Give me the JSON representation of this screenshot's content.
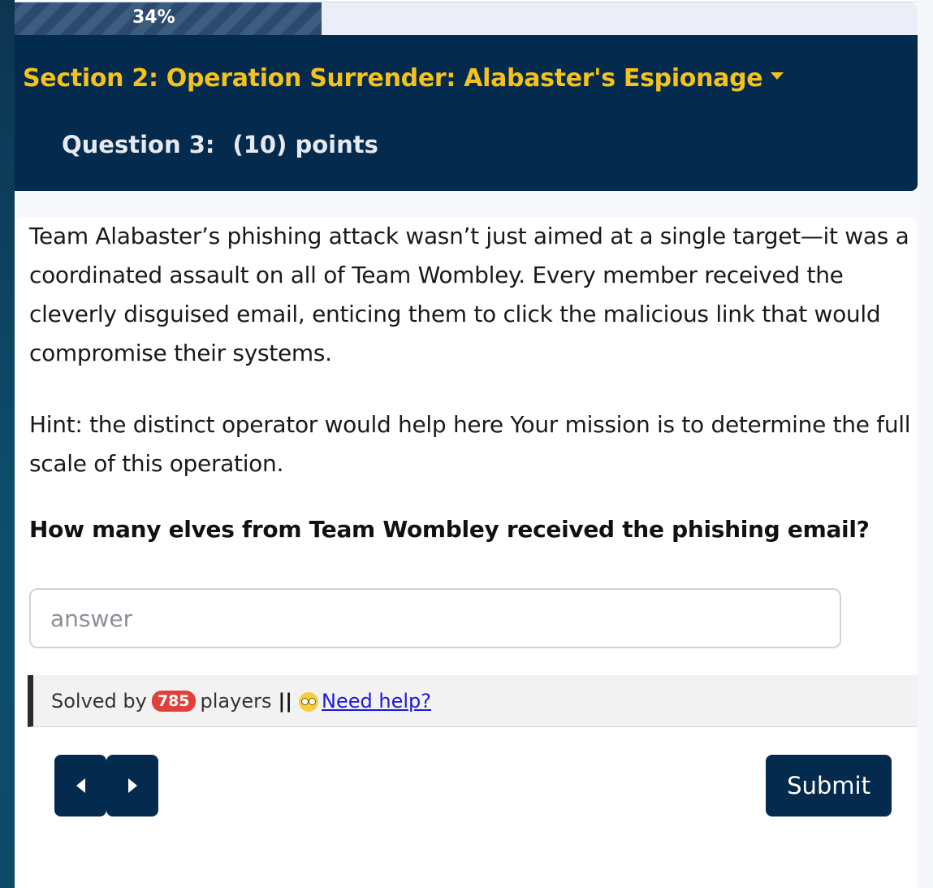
{
  "progress": {
    "label": "34%",
    "value": 0.34
  },
  "header": {
    "section_title": "Section 2: Operation Surrender: Alabaster's Espionage",
    "question_label": "Question 3:",
    "points_label": "(10) points"
  },
  "content": {
    "paragraph1": "Team Alabaster’s phishing attack wasn’t just aimed at a single target—it was a coordinated assault on all of Team Wombley. Every member received the cleverly disguised email, enticing them to click the malicious link that would compromise their systems.",
    "paragraph2": "Hint: the distinct operator would help here Your mission is to determine the full scale of this operation.",
    "question": "How many elves from Team Wombley received the phishing email?"
  },
  "answer": {
    "placeholder": "answer",
    "value": ""
  },
  "solved": {
    "prefix": "Solved by",
    "count": "785",
    "suffix": "players",
    "separator": "||",
    "help_link": "Need help?",
    "help_icon": "confused-face-icon"
  },
  "nav": {
    "prev_icon": "caret-left-icon",
    "next_icon": "caret-right-icon",
    "submit_label": "Submit"
  },
  "colors": {
    "header_bg": "#042a4d",
    "title": "#f5c21b",
    "badge": "#e2403a"
  }
}
